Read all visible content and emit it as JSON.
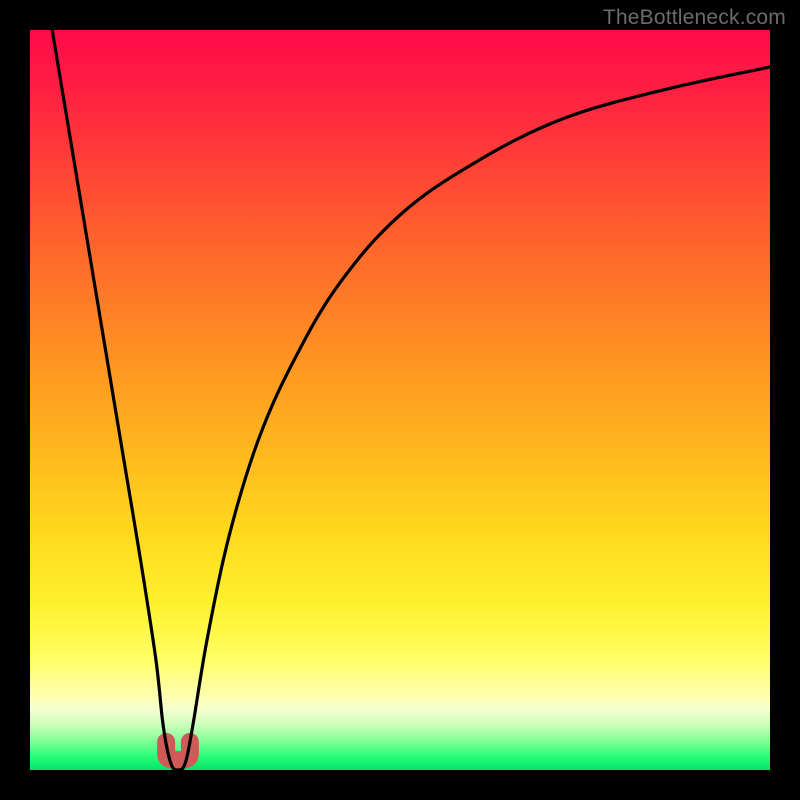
{
  "watermark": "TheBottleneck.com",
  "chart_data": {
    "type": "line",
    "title": "",
    "xlabel": "",
    "ylabel": "",
    "xlim": [
      0,
      100
    ],
    "ylim": [
      0,
      100
    ],
    "grid": false,
    "legend": false,
    "series": [
      {
        "name": "bottleneck-curve",
        "x": [
          3,
          5,
          7,
          9,
          11,
          13,
          15,
          17,
          18,
          19,
          20,
          21,
          22,
          24,
          27,
          31,
          36,
          42,
          50,
          60,
          72,
          86,
          100
        ],
        "values": [
          100,
          88,
          76,
          64,
          52,
          40,
          28,
          15,
          6,
          1,
          0,
          1,
          6,
          18,
          32,
          45,
          56,
          66,
          75,
          82,
          88,
          92,
          95
        ]
      }
    ],
    "marker": {
      "name": "optimal-u-marker",
      "x_center": 20,
      "x_span": 3.2,
      "y_base": 0,
      "y_top": 3.8,
      "color": "#cf5a57",
      "stroke_width_px": 18
    },
    "background_gradient_stops": [
      {
        "pos": 0.0,
        "color": "#ff0a4a"
      },
      {
        "pos": 0.45,
        "color": "#ff9522"
      },
      {
        "pos": 0.78,
        "color": "#fff230"
      },
      {
        "pos": 0.92,
        "color": "#f2ffd0"
      },
      {
        "pos": 1.0,
        "color": "#00e46a"
      }
    ]
  }
}
